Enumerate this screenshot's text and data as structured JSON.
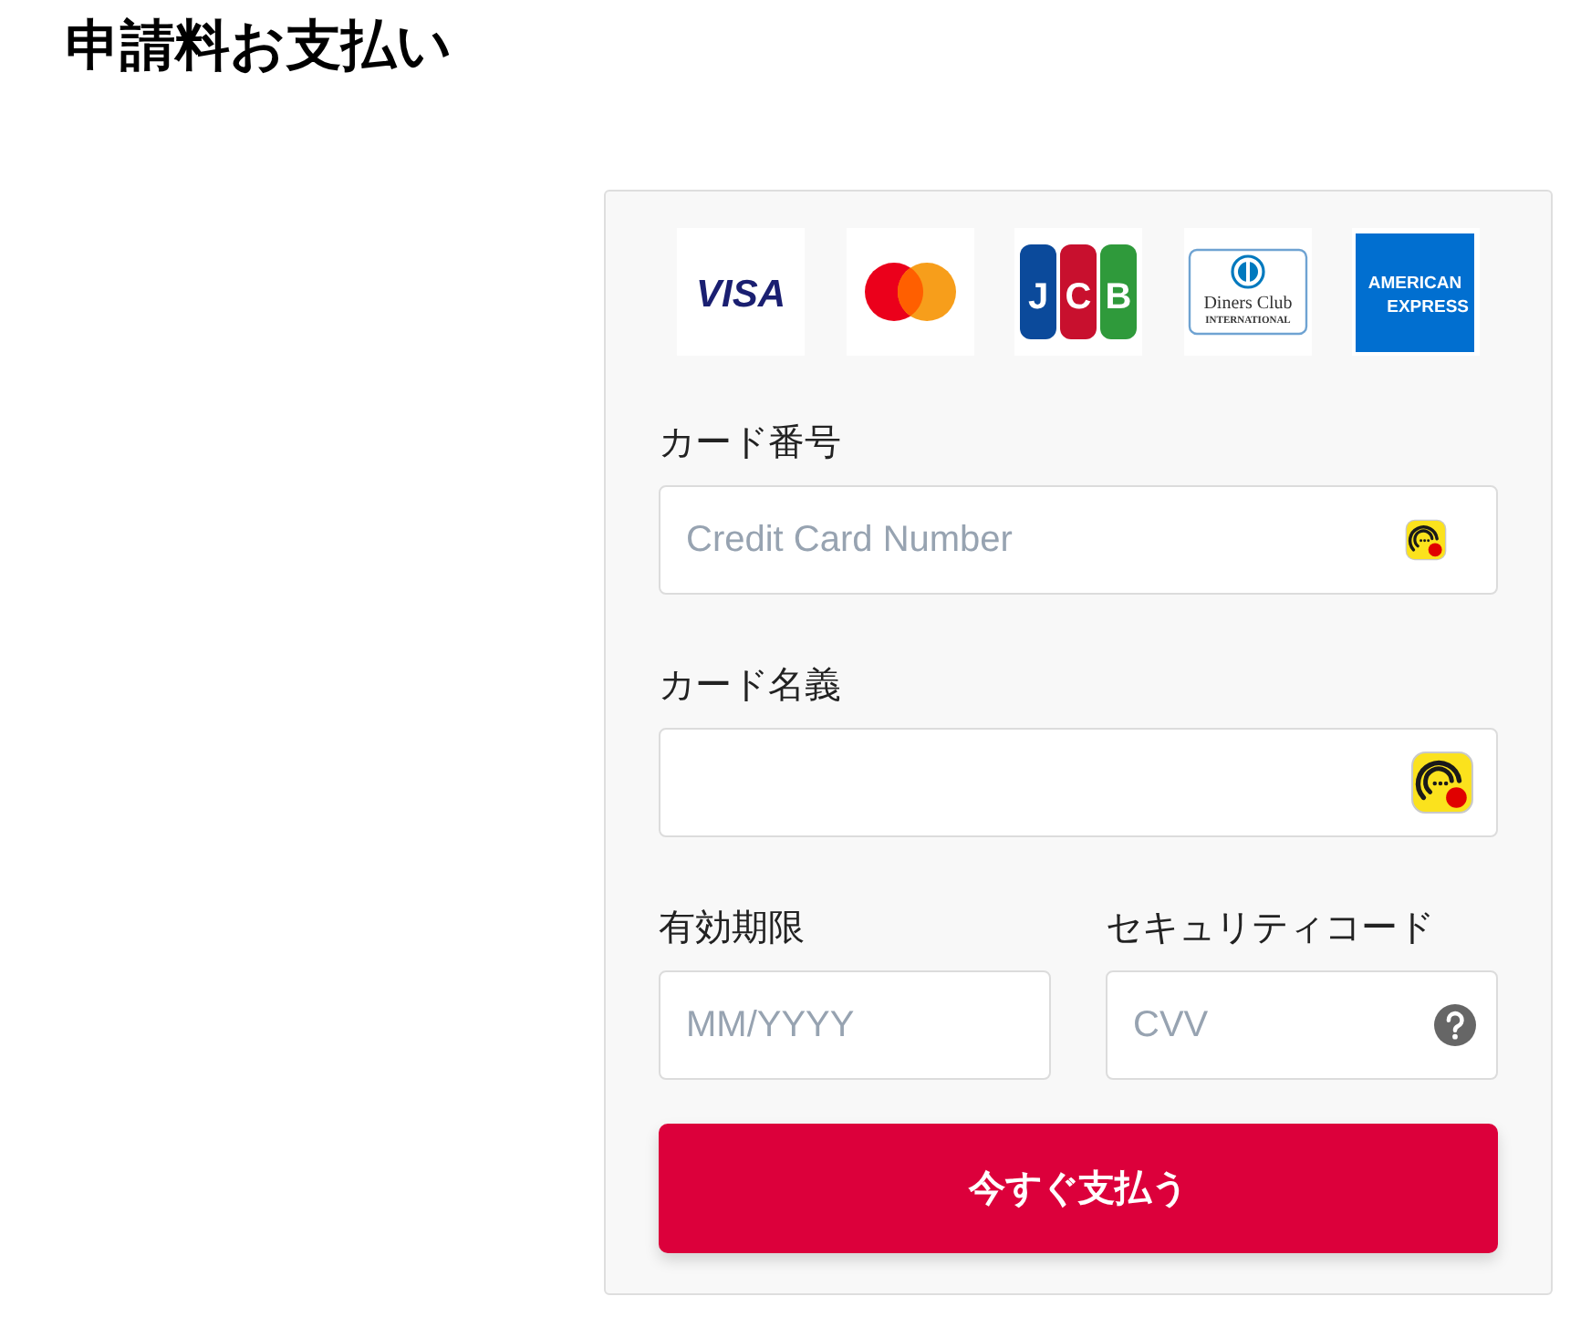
{
  "title": "申請料お支払い",
  "card_brands": [
    {
      "kind": "visa",
      "text": "VISA"
    },
    {
      "kind": "mastercard"
    },
    {
      "kind": "jcb",
      "text": "JCB"
    },
    {
      "kind": "diners",
      "text": "Diners Club",
      "subtext": "INTERNATIONAL"
    },
    {
      "kind": "amex",
      "text": "AMERICAN",
      "subtext": "EXPRESS"
    }
  ],
  "rows": [
    [
      {
        "kind": "assisted",
        "label": "カード番号",
        "placeholder": "Credit Card Number"
      }
    ],
    [
      {
        "kind": "assistedwide",
        "label": "カード名義"
      }
    ],
    [
      {
        "kind": "plain",
        "label": "有効期限",
        "placeholder": "MM/YYYY"
      },
      {
        "kind": "helped",
        "label": "セキュリティコード",
        "placeholder": "CVV"
      }
    ]
  ],
  "submit_button": "今すぐ支払う"
}
